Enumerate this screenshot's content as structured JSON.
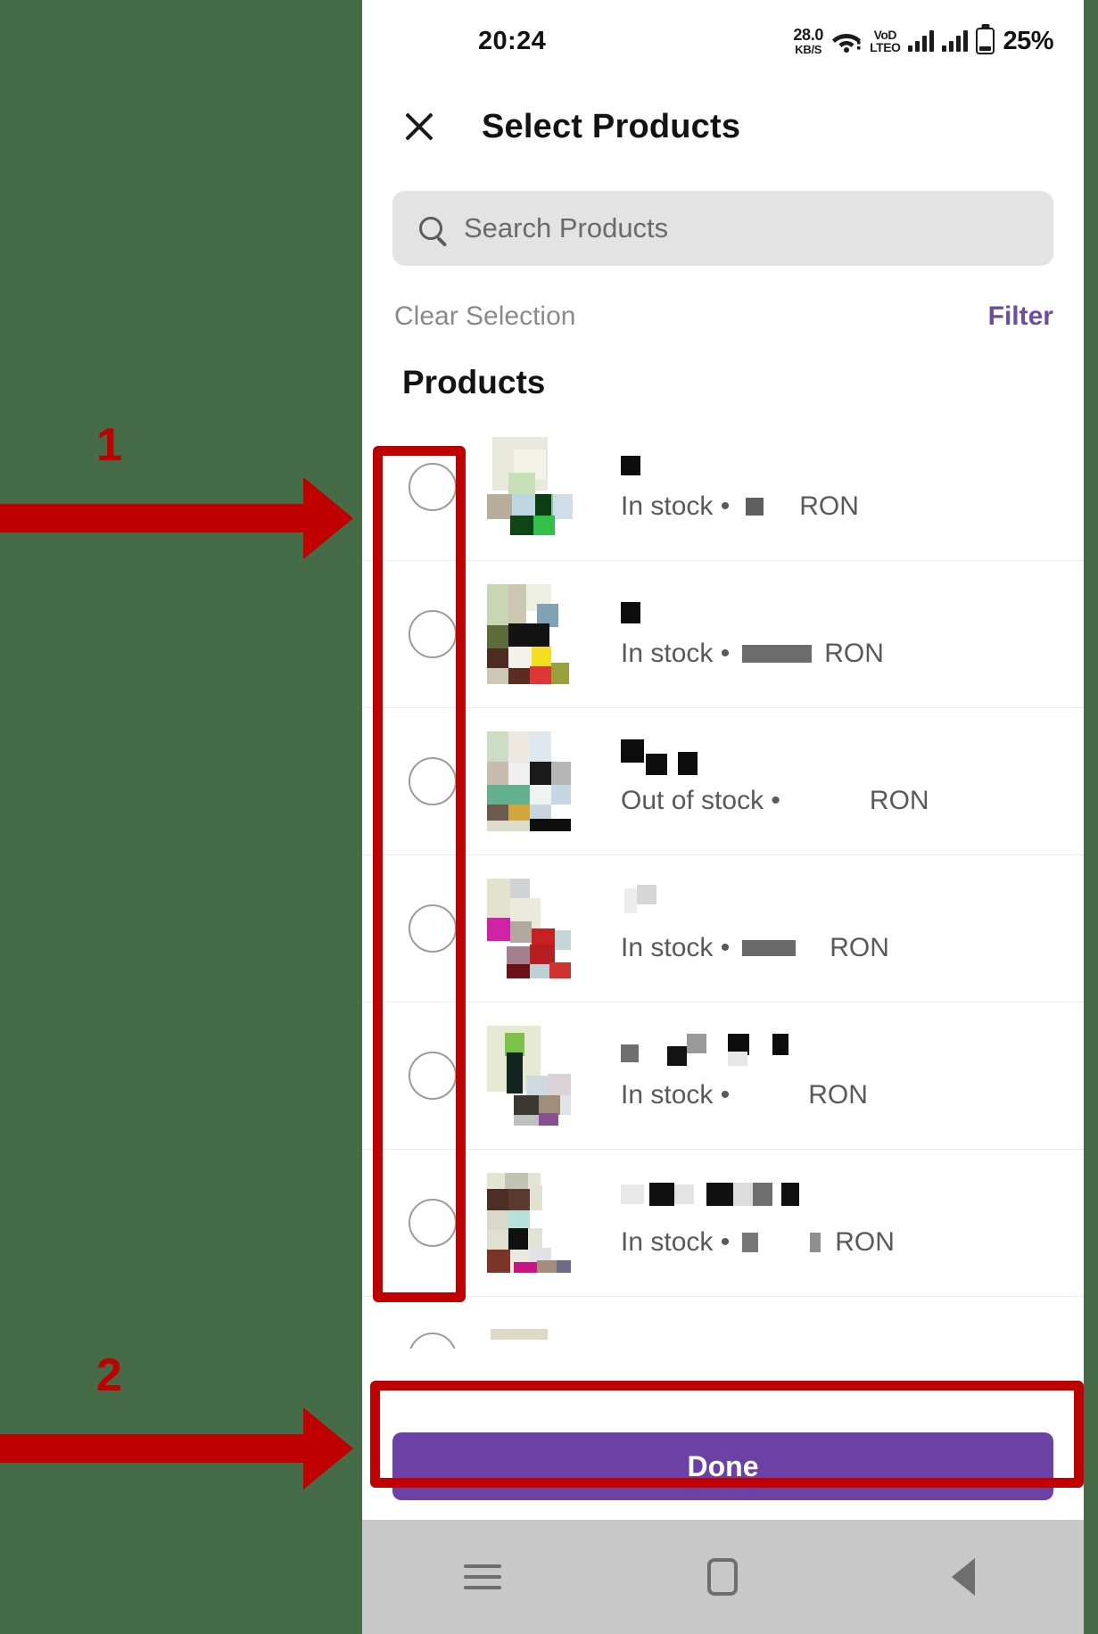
{
  "annotations": [
    {
      "number": "1",
      "target": "product-checkbox-column"
    },
    {
      "number": "2",
      "target": "done-button"
    }
  ],
  "statusbar": {
    "time": "20:24",
    "net_speed_value": "28.0",
    "net_speed_unit": "KB/S",
    "wifi_icon": "wifi-icon",
    "volte_top": "VoD",
    "volte_bottom": "LTEO",
    "signal1_icon": "signal-bars-icon",
    "signal2_icon": "signal-bars-icon",
    "battery_icon": "battery-icon",
    "battery_percent": "25%"
  },
  "appbar": {
    "close_icon": "close-icon",
    "title": "Select Products"
  },
  "search": {
    "icon": "search-icon",
    "placeholder": "Search Products",
    "value": ""
  },
  "actions": {
    "clear_selection": "Clear Selection",
    "filter": "Filter"
  },
  "section": {
    "title": "Products"
  },
  "products": [
    {
      "name": "█",
      "stock": "In stock •",
      "price": "█",
      "currency": "RON",
      "selected": false
    },
    {
      "name": "█",
      "stock": "In stock •",
      "price": "███",
      "currency": "RON",
      "selected": false
    },
    {
      "name": "███",
      "stock": "Out of stock •",
      "price": "",
      "currency": "RON",
      "selected": false
    },
    {
      "name": "█",
      "stock": "In stock •",
      "price": "██",
      "currency": "RON",
      "selected": false
    },
    {
      "name": "█████",
      "stock": "In stock •",
      "price": "",
      "currency": "RON",
      "selected": false
    },
    {
      "name": "██████",
      "stock": "In stock •",
      "price": "█ █",
      "currency": "RON",
      "selected": false
    }
  ],
  "bottom": {
    "done_label": "Done"
  },
  "navbar": {
    "menu_icon": "menu-icon",
    "home_icon": "home-icon",
    "back_icon": "back-icon"
  },
  "colors": {
    "background": "#456b47",
    "accent": "#6b41a5",
    "annotation": "#c00000",
    "filter_link": "#6c4d9e",
    "search_field": "#e3e3e3",
    "navbar": "#c8c8c8"
  }
}
